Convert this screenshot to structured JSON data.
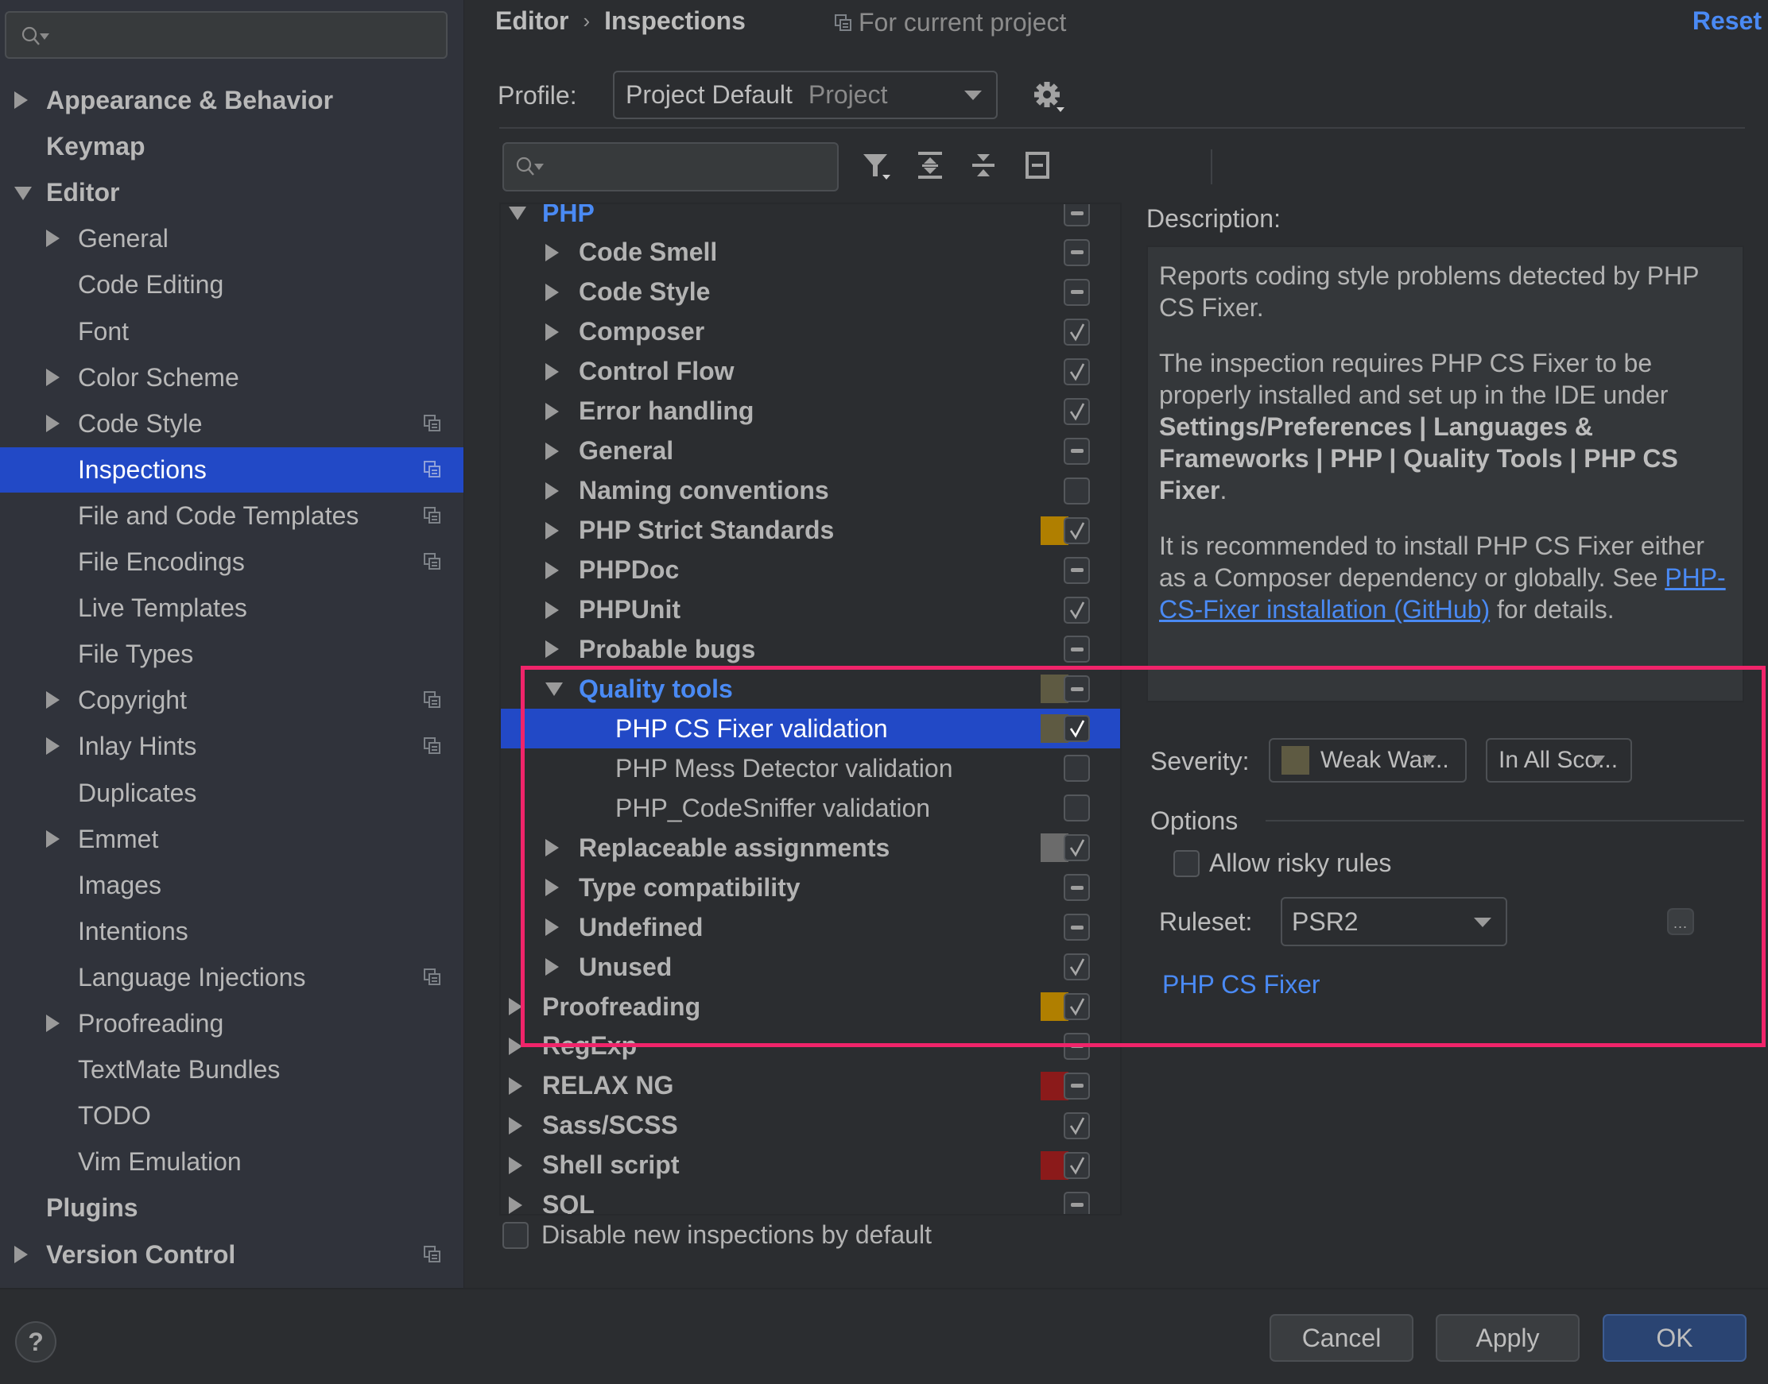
{
  "sidebar": {
    "search": {
      "placeholder": "",
      "value": ""
    },
    "items": [
      {
        "label": "Appearance & Behavior",
        "level": 0,
        "bold": true,
        "arrow": "right",
        "project_icon": false
      },
      {
        "label": "Keymap",
        "level": 0,
        "bold": true,
        "arrow": "none",
        "project_icon": false
      },
      {
        "label": "Editor",
        "level": 0,
        "bold": true,
        "arrow": "down",
        "project_icon": false
      },
      {
        "label": "General",
        "level": 1,
        "bold": false,
        "arrow": "right",
        "project_icon": false
      },
      {
        "label": "Code Editing",
        "level": 1,
        "bold": false,
        "arrow": "none",
        "project_icon": false
      },
      {
        "label": "Font",
        "level": 1,
        "bold": false,
        "arrow": "none",
        "project_icon": false
      },
      {
        "label": "Color Scheme",
        "level": 1,
        "bold": false,
        "arrow": "right",
        "project_icon": false
      },
      {
        "label": "Code Style",
        "level": 1,
        "bold": false,
        "arrow": "right",
        "project_icon": true
      },
      {
        "label": "Inspections",
        "level": 1,
        "bold": false,
        "arrow": "none",
        "project_icon": true,
        "selected": true
      },
      {
        "label": "File and Code Templates",
        "level": 1,
        "bold": false,
        "arrow": "none",
        "project_icon": true
      },
      {
        "label": "File Encodings",
        "level": 1,
        "bold": false,
        "arrow": "none",
        "project_icon": true
      },
      {
        "label": "Live Templates",
        "level": 1,
        "bold": false,
        "arrow": "none",
        "project_icon": false
      },
      {
        "label": "File Types",
        "level": 1,
        "bold": false,
        "arrow": "none",
        "project_icon": false
      },
      {
        "label": "Copyright",
        "level": 1,
        "bold": false,
        "arrow": "right",
        "project_icon": true
      },
      {
        "label": "Inlay Hints",
        "level": 1,
        "bold": false,
        "arrow": "right",
        "project_icon": true
      },
      {
        "label": "Duplicates",
        "level": 1,
        "bold": false,
        "arrow": "none",
        "project_icon": false
      },
      {
        "label": "Emmet",
        "level": 1,
        "bold": false,
        "arrow": "right",
        "project_icon": false
      },
      {
        "label": "Images",
        "level": 1,
        "bold": false,
        "arrow": "none",
        "project_icon": false
      },
      {
        "label": "Intentions",
        "level": 1,
        "bold": false,
        "arrow": "none",
        "project_icon": false
      },
      {
        "label": "Language Injections",
        "level": 1,
        "bold": false,
        "arrow": "none",
        "project_icon": true
      },
      {
        "label": "Proofreading",
        "level": 1,
        "bold": false,
        "arrow": "right",
        "project_icon": false
      },
      {
        "label": "TextMate Bundles",
        "level": 1,
        "bold": false,
        "arrow": "none",
        "project_icon": false
      },
      {
        "label": "TODO",
        "level": 1,
        "bold": false,
        "arrow": "none",
        "project_icon": false
      },
      {
        "label": "Vim Emulation",
        "level": 1,
        "bold": false,
        "arrow": "none",
        "project_icon": false
      },
      {
        "label": "Plugins",
        "level": 0,
        "bold": true,
        "arrow": "none",
        "project_icon": false
      },
      {
        "label": "Version Control",
        "level": 0,
        "bold": true,
        "arrow": "right",
        "project_icon": true
      }
    ]
  },
  "header": {
    "breadcrumb": [
      "Editor",
      "Inspections"
    ],
    "breadcrumb_separator": "›",
    "scope_note": "For current project",
    "reset_label": "Reset"
  },
  "profile": {
    "label": "Profile:",
    "value": "Project Default",
    "value_sub": "Project"
  },
  "tree_search": {
    "placeholder": "",
    "value": ""
  },
  "toolbar": {
    "icons": [
      "filter-icon",
      "expand-all-icon",
      "collapse-all-icon",
      "reset-to-empty-icon"
    ]
  },
  "tree": {
    "rows": [
      {
        "label": "PHP",
        "level": 0,
        "arrow": "down",
        "style": "group-open",
        "severity_color": null,
        "check": "partial"
      },
      {
        "label": "Code Smell",
        "level": 1,
        "arrow": "right",
        "style": "bold",
        "severity_color": null,
        "check": "partial"
      },
      {
        "label": "Code Style",
        "level": 1,
        "arrow": "right",
        "style": "bold",
        "severity_color": null,
        "check": "partial"
      },
      {
        "label": "Composer",
        "level": 1,
        "arrow": "right",
        "style": "bold",
        "severity_color": null,
        "check": "checked"
      },
      {
        "label": "Control Flow",
        "level": 1,
        "arrow": "right",
        "style": "bold",
        "severity_color": null,
        "check": "checked"
      },
      {
        "label": "Error handling",
        "level": 1,
        "arrow": "right",
        "style": "bold",
        "severity_color": null,
        "check": "checked"
      },
      {
        "label": "General",
        "level": 1,
        "arrow": "right",
        "style": "bold",
        "severity_color": null,
        "check": "partial"
      },
      {
        "label": "Naming conventions",
        "level": 1,
        "arrow": "right",
        "style": "bold",
        "severity_color": null,
        "check": "unchecked"
      },
      {
        "label": "PHP Strict Standards",
        "level": 1,
        "arrow": "right",
        "style": "bold",
        "severity_color": "#b07f00",
        "check": "checked"
      },
      {
        "label": "PHPDoc",
        "level": 1,
        "arrow": "right",
        "style": "bold",
        "severity_color": null,
        "check": "partial"
      },
      {
        "label": "PHPUnit",
        "level": 1,
        "arrow": "right",
        "style": "bold",
        "severity_color": null,
        "check": "checked"
      },
      {
        "label": "Probable bugs",
        "level": 1,
        "arrow": "right",
        "style": "bold",
        "severity_color": null,
        "check": "partial"
      },
      {
        "label": "Quality tools",
        "level": 1,
        "arrow": "down",
        "style": "group-open",
        "severity_color": "#5e5a42",
        "check": "partial"
      },
      {
        "label": "PHP CS Fixer validation",
        "level": 2,
        "arrow": "none",
        "style": "selected",
        "severity_color": "#5e5a42",
        "check": "checked"
      },
      {
        "label": "PHP Mess Detector validation",
        "level": 2,
        "arrow": "none",
        "style": "normal",
        "severity_color": null,
        "check": "unchecked"
      },
      {
        "label": "PHP_CodeSniffer validation",
        "level": 2,
        "arrow": "none",
        "style": "normal",
        "severity_color": null,
        "check": "unchecked"
      },
      {
        "label": "Replaceable assignments",
        "level": 1,
        "arrow": "right",
        "style": "bold",
        "severity_color": "#6b6b6b",
        "check": "checked"
      },
      {
        "label": "Type compatibility",
        "level": 1,
        "arrow": "right",
        "style": "bold",
        "severity_color": null,
        "check": "partial"
      },
      {
        "label": "Undefined",
        "level": 1,
        "arrow": "right",
        "style": "bold",
        "severity_color": null,
        "check": "partial"
      },
      {
        "label": "Unused",
        "level": 1,
        "arrow": "right",
        "style": "bold",
        "severity_color": null,
        "check": "checked"
      },
      {
        "label": "Proofreading",
        "level": 0,
        "arrow": "right",
        "style": "bold",
        "severity_color": "#b07f00",
        "check": "checked"
      },
      {
        "label": "RegExp",
        "level": 0,
        "arrow": "right",
        "style": "bold",
        "severity_color": null,
        "check": "partial"
      },
      {
        "label": "RELAX NG",
        "level": 0,
        "arrow": "right",
        "style": "bold",
        "severity_color": "#8b1a1a",
        "check": "partial"
      },
      {
        "label": "Sass/SCSS",
        "level": 0,
        "arrow": "right",
        "style": "bold",
        "severity_color": null,
        "check": "checked"
      },
      {
        "label": "Shell script",
        "level": 0,
        "arrow": "right",
        "style": "bold",
        "severity_color": "#8b1a1a",
        "check": "checked"
      },
      {
        "label": "SQL",
        "level": 0,
        "arrow": "right",
        "style": "bold",
        "severity_color": null,
        "check": "partial"
      }
    ],
    "disable_new_label": "Disable new inspections by default",
    "disable_new_checked": false
  },
  "description": {
    "label": "Description:",
    "p1": "Reports coding style problems detected by PHP CS Fixer.",
    "p2_pre": "The inspection requires PHP CS Fixer to be properly installed and set up in the IDE under ",
    "p2_bold": "Settings/Preferences | Languages & Frameworks | PHP | Quality Tools | PHP CS Fixer",
    "p2_post": ".",
    "p3_pre": "It is recommended to install PHP CS Fixer either as a Composer dependency or globally. See ",
    "p3_link": "PHP-CS-Fixer installation (GitHub)",
    "p3_post": " for details."
  },
  "severity": {
    "label": "Severity:",
    "value": "Weak War...",
    "swatch_color": "#5e5a42",
    "scope_value": "In All Sco..."
  },
  "options": {
    "label": "Options",
    "allow_risky_label": "Allow risky rules",
    "allow_risky_checked": false,
    "ruleset_label": "Ruleset:",
    "ruleset_value": "PSR2",
    "ellipsis_label": "...",
    "tool_link": "PHP CS Fixer"
  },
  "footer": {
    "help_label": "?",
    "cancel_label": "Cancel",
    "apply_label": "Apply",
    "ok_label": "OK"
  },
  "colors": {
    "accent": "#4a8af4",
    "selection": "#2249c6",
    "highlight_box": "#f0246a"
  }
}
